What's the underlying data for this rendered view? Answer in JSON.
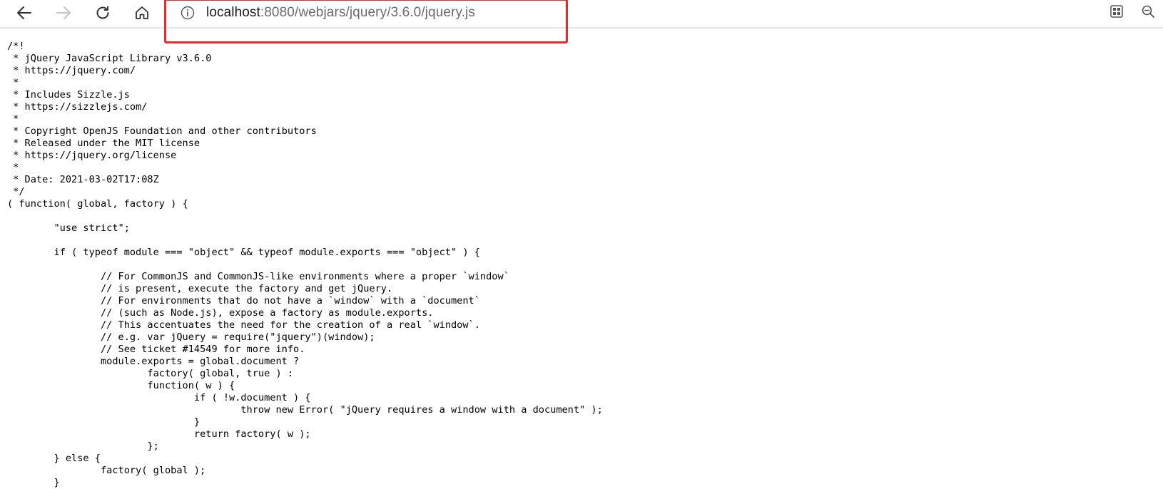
{
  "browser": {
    "address_bar": {
      "url_host": "localhost",
      "url_rest": ":8080/webjars/jquery/3.6.0/jquery.js"
    },
    "icons": {
      "back": "arrow-left-icon",
      "forward": "arrow-right-icon",
      "refresh": "refresh-icon",
      "home": "home-icon",
      "site_info": "info-icon",
      "apps": "apps-grid-icon",
      "zoom": "zoom-out-icon"
    },
    "annotation_color": "#e8282b"
  },
  "page": {
    "code_lines": [
      "/*!",
      " * jQuery JavaScript Library v3.6.0",
      " * https://jquery.com/",
      " *",
      " * Includes Sizzle.js",
      " * https://sizzlejs.com/",
      " *",
      " * Copyright OpenJS Foundation and other contributors",
      " * Released under the MIT license",
      " * https://jquery.org/license",
      " *",
      " * Date: 2021-03-02T17:08Z",
      " */",
      "( function( global, factory ) {",
      "",
      "\t\"use strict\";",
      "",
      "\tif ( typeof module === \"object\" && typeof module.exports === \"object\" ) {",
      "",
      "\t\t// For CommonJS and CommonJS-like environments where a proper `window`",
      "\t\t// is present, execute the factory and get jQuery.",
      "\t\t// For environments that do not have a `window` with a `document`",
      "\t\t// (such as Node.js), expose a factory as module.exports.",
      "\t\t// This accentuates the need for the creation of a real `window`.",
      "\t\t// e.g. var jQuery = require(\"jquery\")(window);",
      "\t\t// See ticket #14549 for more info.",
      "\t\tmodule.exports = global.document ?",
      "\t\t\tfactory( global, true ) :",
      "\t\t\tfunction( w ) {",
      "\t\t\t\tif ( !w.document ) {",
      "\t\t\t\t\tthrow new Error( \"jQuery requires a window with a document\" );",
      "\t\t\t\t}",
      "\t\t\t\treturn factory( w );",
      "\t\t\t};",
      "\t} else {",
      "\t\tfactory( global );",
      "\t}"
    ]
  }
}
